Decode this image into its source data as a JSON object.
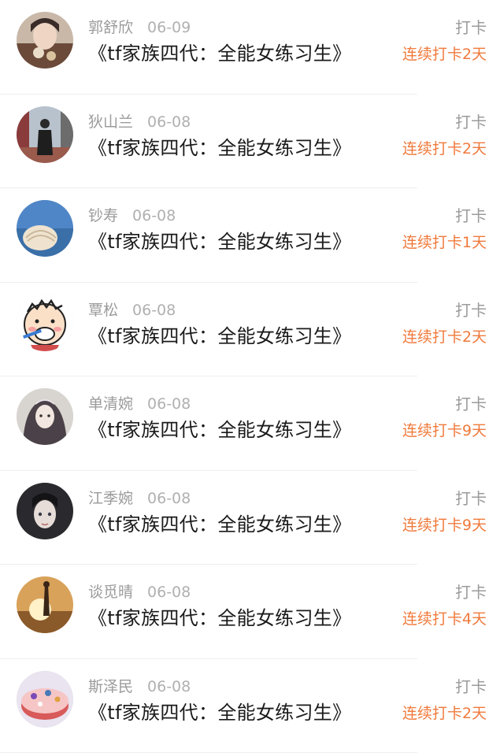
{
  "entries": [
    {
      "name": "郭舒欣",
      "date": "06-09",
      "title": "《tf家族四代：全能女练习生》",
      "checkin_label": "打卡",
      "streak": "连续打卡2天",
      "avatar_icon": "avatar-selfie"
    },
    {
      "name": "狄山兰",
      "date": "06-08",
      "title": "《tf家族四代：全能女练习生》",
      "checkin_label": "打卡",
      "streak": "连续打卡2天",
      "avatar_icon": "avatar-street"
    },
    {
      "name": "钞寿",
      "date": "06-08",
      "title": "《tf家族四代：全能女练习生》",
      "checkin_label": "打卡",
      "streak": "连续打卡1天",
      "avatar_icon": "avatar-seashell"
    },
    {
      "name": "覃松",
      "date": "06-08",
      "title": "《tf家族四代：全能女练习生》",
      "checkin_label": "打卡",
      "streak": "连续打卡2天",
      "avatar_icon": "avatar-cartoon-boy"
    },
    {
      "name": "单清婉",
      "date": "06-08",
      "title": "《tf家族四代：全能女练习生》",
      "checkin_label": "打卡",
      "streak": "连续打卡9天",
      "avatar_icon": "avatar-anime-girl"
    },
    {
      "name": "江季婉",
      "date": "06-08",
      "title": "《tf家族四代：全能女练习生》",
      "checkin_label": "打卡",
      "streak": "连续打卡9天",
      "avatar_icon": "avatar-anime-portrait"
    },
    {
      "name": "谈觅晴",
      "date": "06-08",
      "title": "《tf家族四代：全能女练习生》",
      "checkin_label": "打卡",
      "streak": "连续打卡4天",
      "avatar_icon": "avatar-sunset"
    },
    {
      "name": "斯泽民",
      "date": "06-08",
      "title": "《tf家族四代：全能女练习生》",
      "checkin_label": "打卡",
      "streak": "连续打卡2天",
      "avatar_icon": "avatar-cake"
    }
  ],
  "colors": {
    "accent": "#f07a3c",
    "muted": "#9b9b9b",
    "text": "#1a1a1a"
  }
}
